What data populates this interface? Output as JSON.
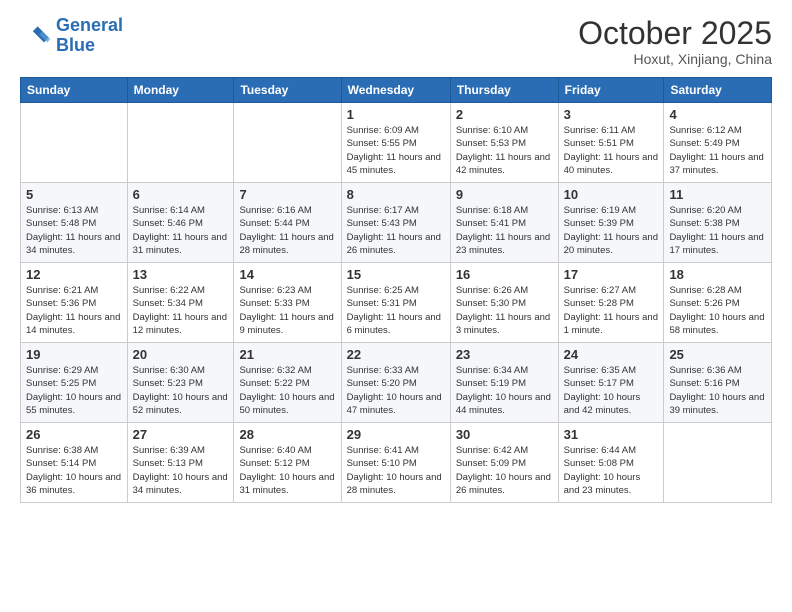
{
  "logo": {
    "line1": "General",
    "line2": "Blue"
  },
  "header": {
    "title": "October 2025",
    "subtitle": "Hoxut, Xinjiang, China"
  },
  "days_of_week": [
    "Sunday",
    "Monday",
    "Tuesday",
    "Wednesday",
    "Thursday",
    "Friday",
    "Saturday"
  ],
  "weeks": [
    [
      {
        "day": "",
        "info": ""
      },
      {
        "day": "",
        "info": ""
      },
      {
        "day": "",
        "info": ""
      },
      {
        "day": "1",
        "info": "Sunrise: 6:09 AM\nSunset: 5:55 PM\nDaylight: 11 hours and 45 minutes."
      },
      {
        "day": "2",
        "info": "Sunrise: 6:10 AM\nSunset: 5:53 PM\nDaylight: 11 hours and 42 minutes."
      },
      {
        "day": "3",
        "info": "Sunrise: 6:11 AM\nSunset: 5:51 PM\nDaylight: 11 hours and 40 minutes."
      },
      {
        "day": "4",
        "info": "Sunrise: 6:12 AM\nSunset: 5:49 PM\nDaylight: 11 hours and 37 minutes."
      }
    ],
    [
      {
        "day": "5",
        "info": "Sunrise: 6:13 AM\nSunset: 5:48 PM\nDaylight: 11 hours and 34 minutes."
      },
      {
        "day": "6",
        "info": "Sunrise: 6:14 AM\nSunset: 5:46 PM\nDaylight: 11 hours and 31 minutes."
      },
      {
        "day": "7",
        "info": "Sunrise: 6:16 AM\nSunset: 5:44 PM\nDaylight: 11 hours and 28 minutes."
      },
      {
        "day": "8",
        "info": "Sunrise: 6:17 AM\nSunset: 5:43 PM\nDaylight: 11 hours and 26 minutes."
      },
      {
        "day": "9",
        "info": "Sunrise: 6:18 AM\nSunset: 5:41 PM\nDaylight: 11 hours and 23 minutes."
      },
      {
        "day": "10",
        "info": "Sunrise: 6:19 AM\nSunset: 5:39 PM\nDaylight: 11 hours and 20 minutes."
      },
      {
        "day": "11",
        "info": "Sunrise: 6:20 AM\nSunset: 5:38 PM\nDaylight: 11 hours and 17 minutes."
      }
    ],
    [
      {
        "day": "12",
        "info": "Sunrise: 6:21 AM\nSunset: 5:36 PM\nDaylight: 11 hours and 14 minutes."
      },
      {
        "day": "13",
        "info": "Sunrise: 6:22 AM\nSunset: 5:34 PM\nDaylight: 11 hours and 12 minutes."
      },
      {
        "day": "14",
        "info": "Sunrise: 6:23 AM\nSunset: 5:33 PM\nDaylight: 11 hours and 9 minutes."
      },
      {
        "day": "15",
        "info": "Sunrise: 6:25 AM\nSunset: 5:31 PM\nDaylight: 11 hours and 6 minutes."
      },
      {
        "day": "16",
        "info": "Sunrise: 6:26 AM\nSunset: 5:30 PM\nDaylight: 11 hours and 3 minutes."
      },
      {
        "day": "17",
        "info": "Sunrise: 6:27 AM\nSunset: 5:28 PM\nDaylight: 11 hours and 1 minute."
      },
      {
        "day": "18",
        "info": "Sunrise: 6:28 AM\nSunset: 5:26 PM\nDaylight: 10 hours and 58 minutes."
      }
    ],
    [
      {
        "day": "19",
        "info": "Sunrise: 6:29 AM\nSunset: 5:25 PM\nDaylight: 10 hours and 55 minutes."
      },
      {
        "day": "20",
        "info": "Sunrise: 6:30 AM\nSunset: 5:23 PM\nDaylight: 10 hours and 52 minutes."
      },
      {
        "day": "21",
        "info": "Sunrise: 6:32 AM\nSunset: 5:22 PM\nDaylight: 10 hours and 50 minutes."
      },
      {
        "day": "22",
        "info": "Sunrise: 6:33 AM\nSunset: 5:20 PM\nDaylight: 10 hours and 47 minutes."
      },
      {
        "day": "23",
        "info": "Sunrise: 6:34 AM\nSunset: 5:19 PM\nDaylight: 10 hours and 44 minutes."
      },
      {
        "day": "24",
        "info": "Sunrise: 6:35 AM\nSunset: 5:17 PM\nDaylight: 10 hours and 42 minutes."
      },
      {
        "day": "25",
        "info": "Sunrise: 6:36 AM\nSunset: 5:16 PM\nDaylight: 10 hours and 39 minutes."
      }
    ],
    [
      {
        "day": "26",
        "info": "Sunrise: 6:38 AM\nSunset: 5:14 PM\nDaylight: 10 hours and 36 minutes."
      },
      {
        "day": "27",
        "info": "Sunrise: 6:39 AM\nSunset: 5:13 PM\nDaylight: 10 hours and 34 minutes."
      },
      {
        "day": "28",
        "info": "Sunrise: 6:40 AM\nSunset: 5:12 PM\nDaylight: 10 hours and 31 minutes."
      },
      {
        "day": "29",
        "info": "Sunrise: 6:41 AM\nSunset: 5:10 PM\nDaylight: 10 hours and 28 minutes."
      },
      {
        "day": "30",
        "info": "Sunrise: 6:42 AM\nSunset: 5:09 PM\nDaylight: 10 hours and 26 minutes."
      },
      {
        "day": "31",
        "info": "Sunrise: 6:44 AM\nSunset: 5:08 PM\nDaylight: 10 hours and 23 minutes."
      },
      {
        "day": "",
        "info": ""
      }
    ]
  ]
}
